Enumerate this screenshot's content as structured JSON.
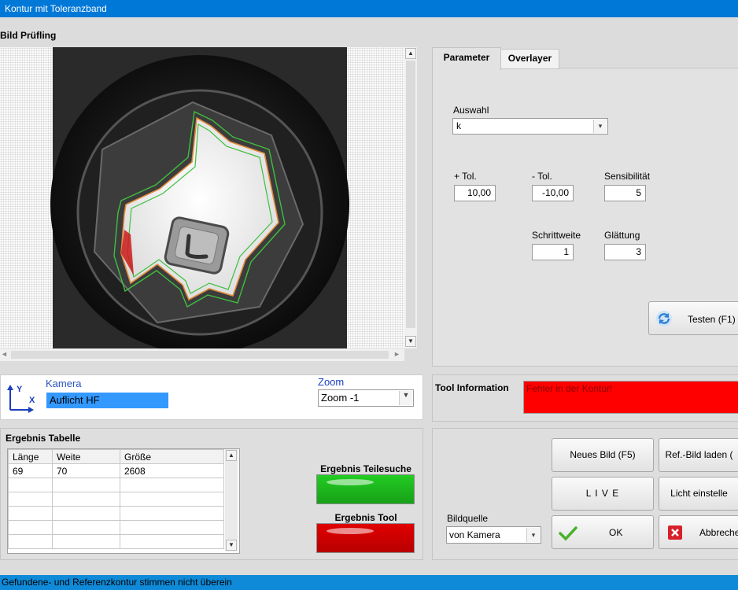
{
  "window": {
    "title": "Kontur mit Toleranzband"
  },
  "image_panel": {
    "title": "Bild Prüfling"
  },
  "camera": {
    "axis_y": "Y",
    "axis_x": "X",
    "label": "Kamera",
    "value": "Auflicht HF"
  },
  "zoom": {
    "label": "Zoom",
    "value": "Zoom -1"
  },
  "tabs": [
    {
      "label": "Parameter"
    },
    {
      "label": "Overlayer"
    }
  ],
  "params": {
    "auswahl_label": "Auswahl",
    "auswahl_value": "k",
    "plus_tol_label": "+ Tol.",
    "plus_tol_value": "10,00",
    "minus_tol_label": "- Tol.",
    "minus_tol_value": "-10,00",
    "sensibilitaet_label": "Sensibilität",
    "sensibilitaet_value": "5",
    "schrittweite_label": "Schrittweite",
    "schrittweite_value": "1",
    "glaettung_label": "Glättung",
    "glaettung_value": "3",
    "test_button": "Testen (F1)"
  },
  "tool_info": {
    "label": "Tool Information",
    "message": "Fehler in der Kontur!",
    "color": "#ff0000"
  },
  "results": {
    "title": "Ergebnis Tabelle",
    "columns": [
      "Länge",
      "Weite",
      "Größe"
    ],
    "rows": [
      [
        "69",
        "70",
        "2608"
      ]
    ]
  },
  "indicators": {
    "teilesuche_label": "Ergebnis Teilesuche",
    "teilesuche_color": "#22cc22",
    "tool_label": "Ergebnis Tool",
    "tool_color": "#e00000"
  },
  "actions": {
    "neues_bild": "Neues Bild (F5)",
    "ref_bild": "Ref.-Bild laden (",
    "live": "L I V E",
    "licht": "Licht einstelle",
    "ok": "OK",
    "abbrechen": "Abbreche"
  },
  "bildquelle": {
    "label": "Bildquelle",
    "value": "von Kamera"
  },
  "status_bar": {
    "text": "Gefundene- und Referenzkontur stimmen nicht überein"
  }
}
